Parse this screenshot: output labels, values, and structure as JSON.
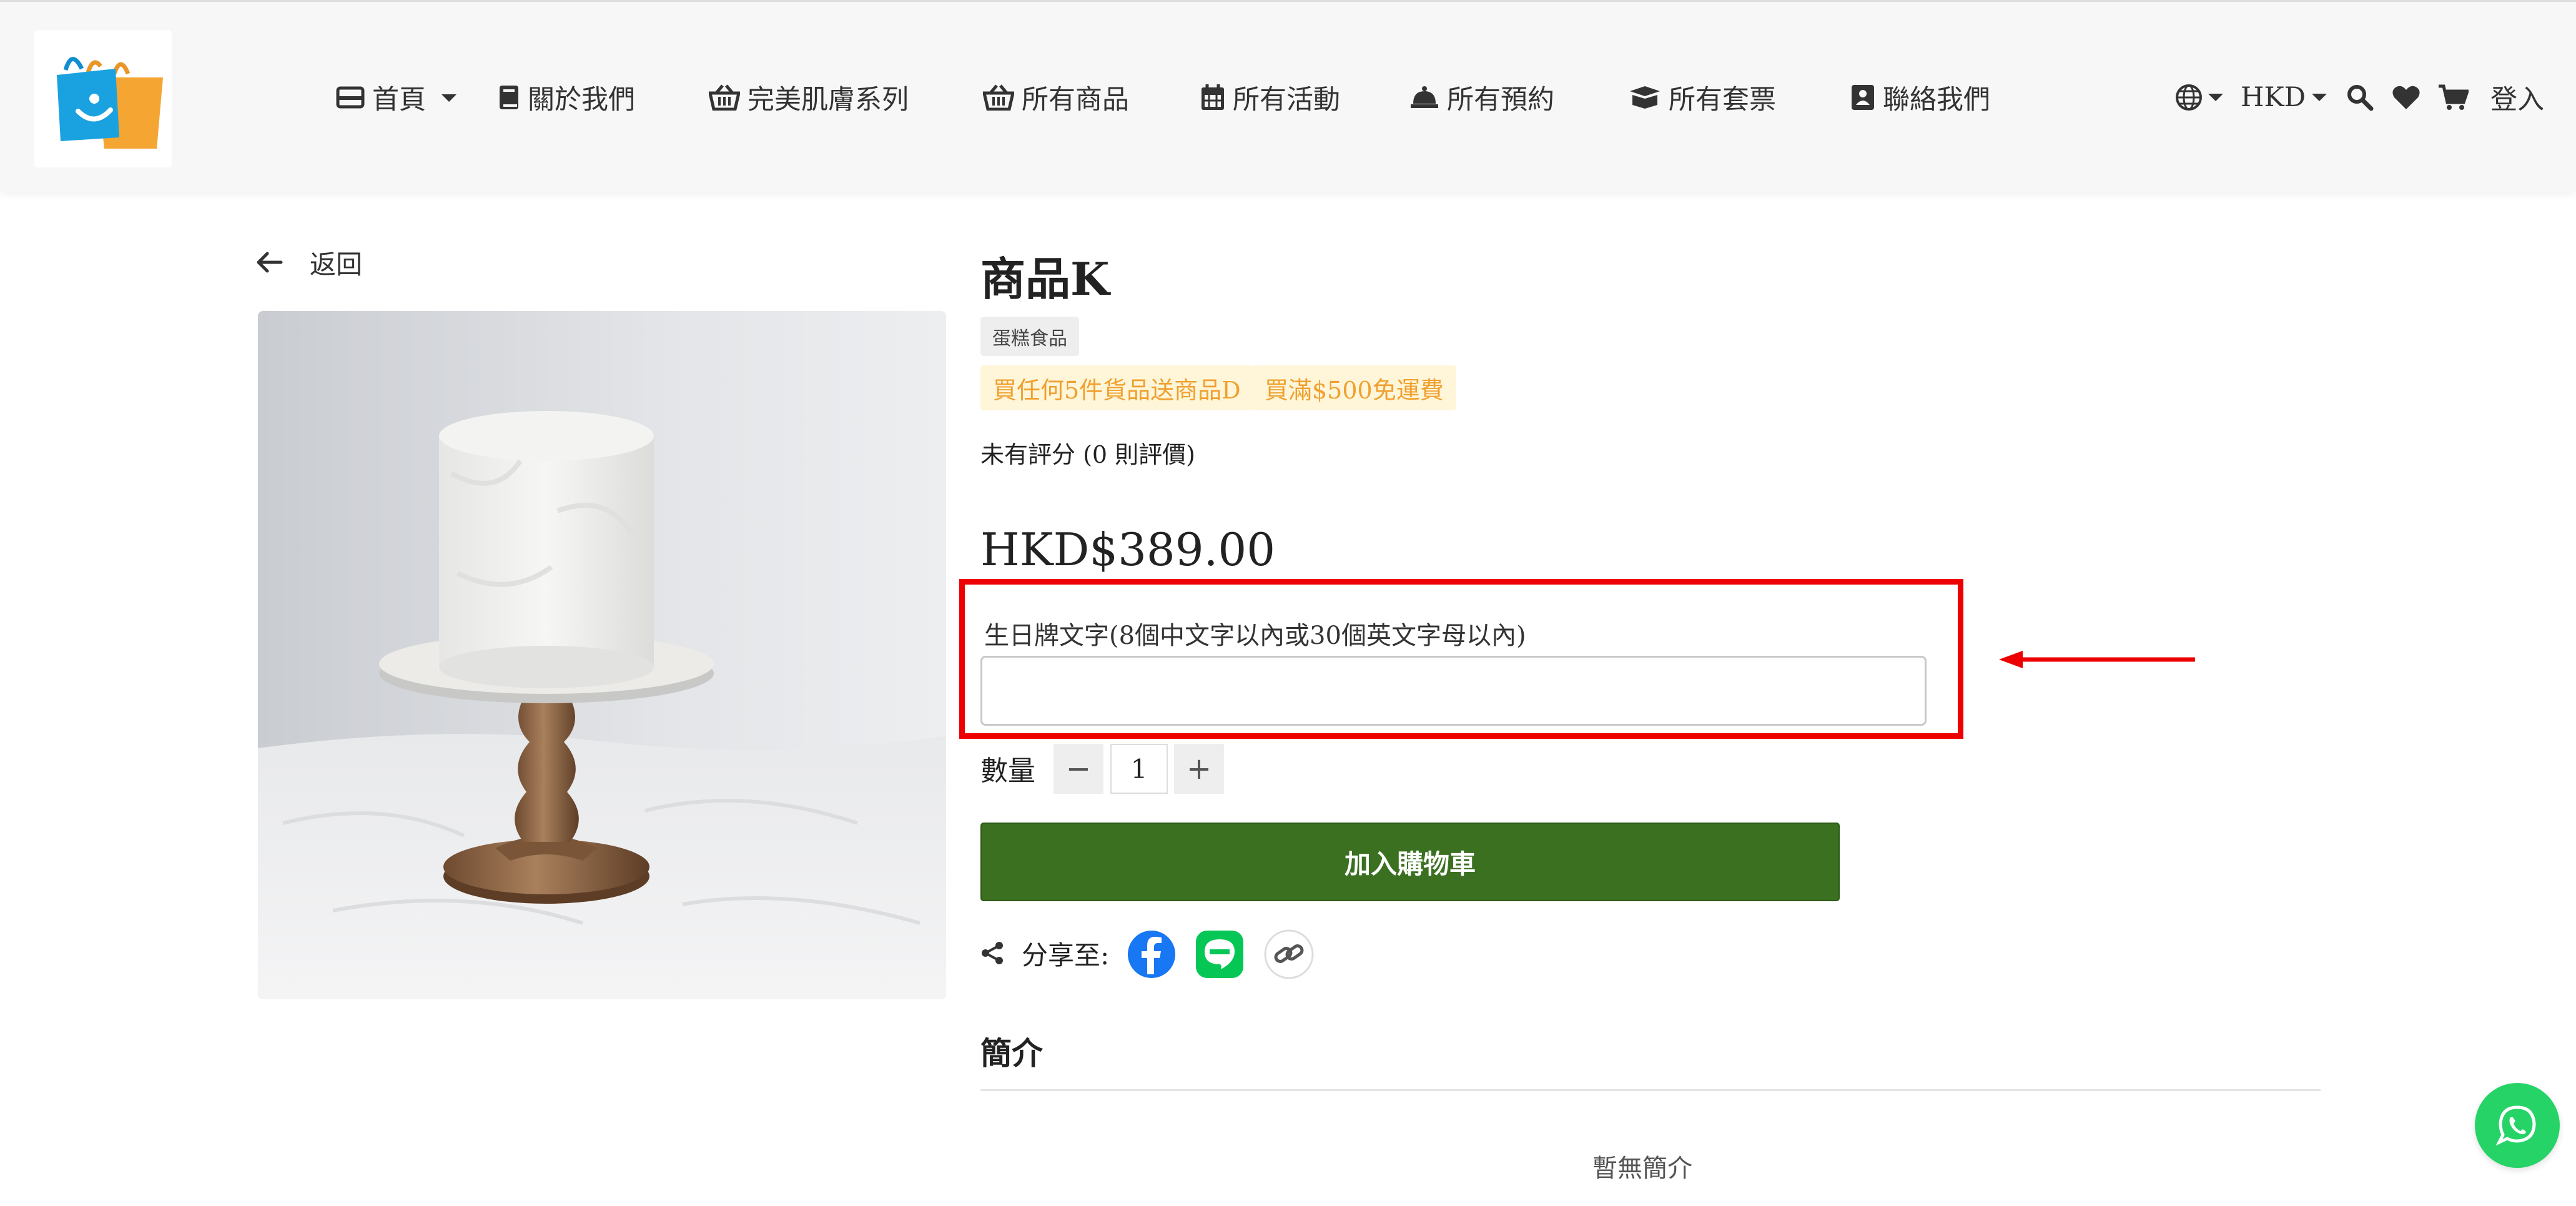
{
  "header": {
    "nav": [
      {
        "label": "首頁",
        "icon": "id-card-icon"
      },
      {
        "label": "關於我們",
        "icon": "book-icon"
      },
      {
        "label": "完美肌膚系列",
        "icon": "basket-icon"
      },
      {
        "label": "所有商品",
        "icon": "basket-icon"
      },
      {
        "label": "所有活動",
        "icon": "calendar-icon"
      },
      {
        "label": "所有預約",
        "icon": "bell-icon"
      },
      {
        "label": "所有套票",
        "icon": "box-icon"
      },
      {
        "label": "聯絡我們",
        "icon": "contact-book-icon"
      }
    ],
    "currency": "HKD",
    "login": "登入"
  },
  "back_label": "返回",
  "product": {
    "title": "商品K",
    "category_tag": "蛋糕食品",
    "promos": [
      "買任何5件貨品送商品D",
      "買滿$500免運費"
    ],
    "rating_text": "未有評分 (0 則評價)",
    "price": "HKD$389.00",
    "custom_field_label": "生日牌文字(8個中文字以內或30個英文字母以內)",
    "custom_field_value": "",
    "quantity_label": "數量",
    "quantity": "1",
    "minus": "−",
    "plus": "+",
    "add_to_cart": "加入購物車",
    "share_label": "分享至:",
    "description_title": "簡介",
    "description_empty": "暫無簡介"
  },
  "colors": {
    "accent_green": "#3a7020",
    "highlight_red": "#ee0000",
    "promo_text": "#f0a030",
    "whatsapp": "#25d366"
  }
}
